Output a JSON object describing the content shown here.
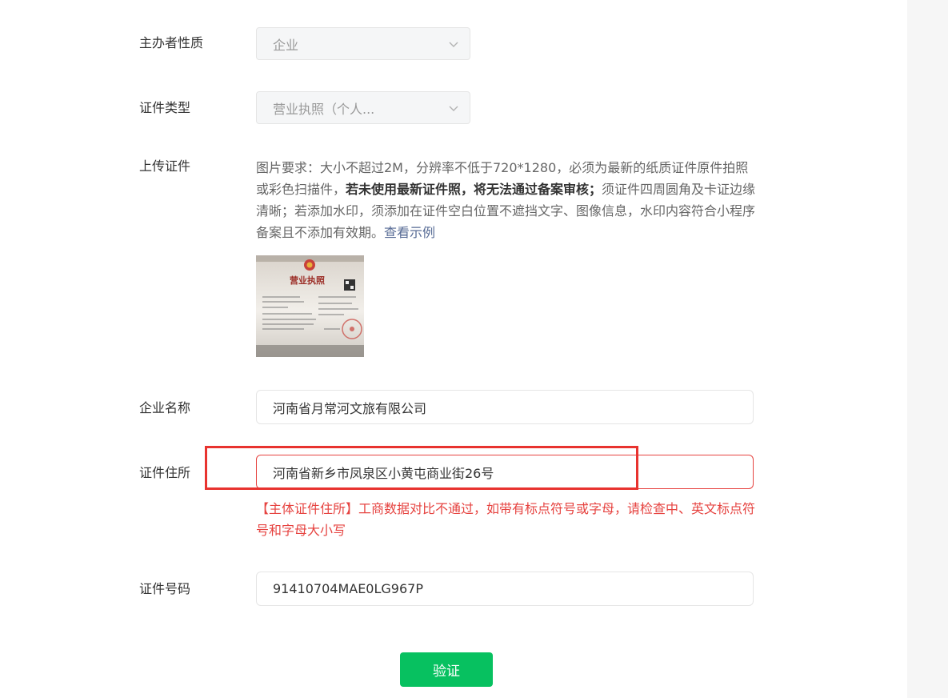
{
  "form": {
    "org_nature": {
      "label": "主办者性质",
      "value": "企业"
    },
    "cert_type": {
      "label": "证件类型",
      "value": "营业执照（个人..."
    },
    "upload": {
      "label": "上传证件",
      "desc_part1": "图片要求：大小不超过2M，分辨率不低于720*1280，必须为最新的纸质证件原件拍照或彩色扫描件，",
      "desc_bold": "若未使用最新证件照，将无法通过备案审核；",
      "desc_part2": "须证件四周圆角及卡证边缘清晰；若添加水印，须添加在证件空白位置不遮挡文字、图像信息，水印内容符合小程序备案且不添加有效期。",
      "example_link": "查看示例",
      "license_image": {
        "title": "营业执照"
      }
    },
    "company_name": {
      "label": "企业名称",
      "value": "河南省月常河文旅有限公司"
    },
    "cert_address": {
      "label": "证件住所",
      "value": "河南省新乡市凤泉区小黄屯商业街26号",
      "error": "【主体证件住所】工商数据对比不通过，如带有标点符号或字母，请检查中、英文标点符号和字母大小写"
    },
    "cert_number": {
      "label": "证件号码",
      "value": "91410704MAE0LG967P"
    },
    "verify_button": "验证"
  },
  "colors": {
    "primary_green": "#07c160",
    "error_red": "#e64340",
    "link_blue": "#576b95",
    "annotation_red": "#e8332f"
  }
}
